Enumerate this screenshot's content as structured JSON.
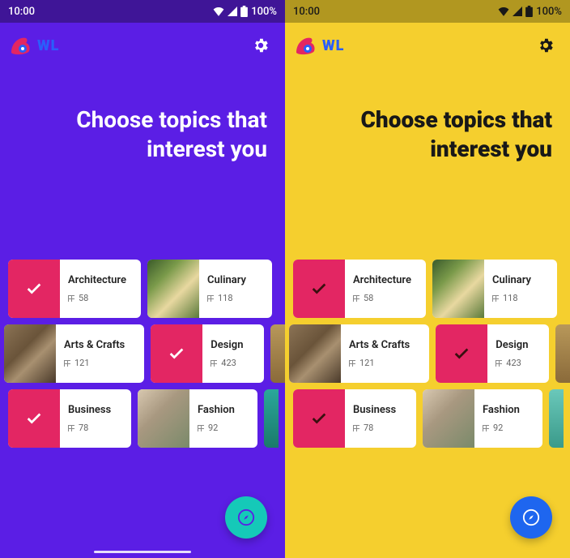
{
  "status": {
    "time": "10:00",
    "battery": "100%"
  },
  "logoText": "WL",
  "title": "Choose topics that interest you",
  "topics": [
    {
      "name": "Architecture",
      "count": "58",
      "selected": true,
      "thumbClass": "arch"
    },
    {
      "name": "Culinary",
      "count": "118",
      "selected": false,
      "thumbClass": "culinary"
    },
    {
      "name": "Arts & Crafts",
      "count": "121",
      "selected": false,
      "thumbClass": "pottery"
    },
    {
      "name": "Design",
      "count": "423",
      "selected": true,
      "thumbClass": ""
    },
    {
      "name": "Business",
      "count": "78",
      "selected": true,
      "thumbClass": ""
    },
    {
      "name": "Fashion",
      "count": "92",
      "selected": false,
      "thumbClass": "hands"
    }
  ]
}
